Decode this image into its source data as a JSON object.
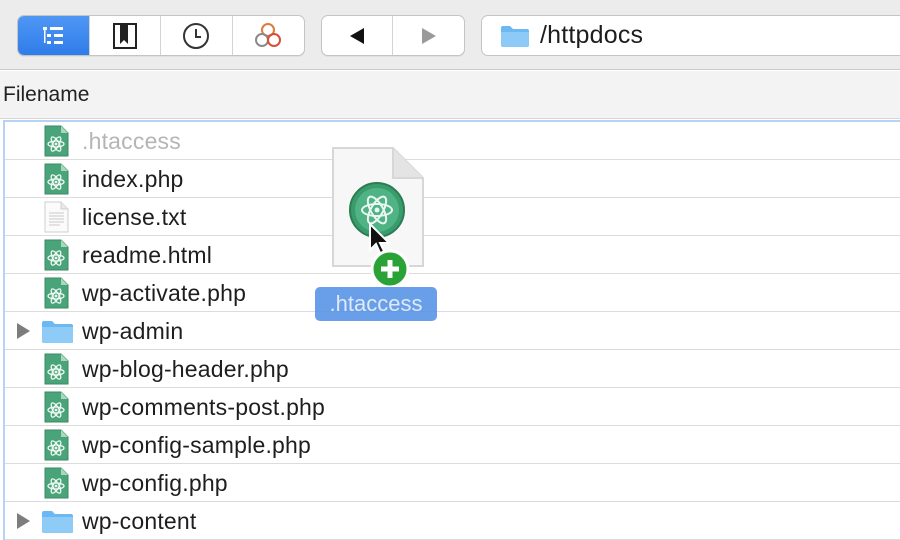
{
  "toolbar": {
    "view_buttons": [
      {
        "icon": "outline-view-icon",
        "active": true
      },
      {
        "icon": "bookmark-icon",
        "active": false
      },
      {
        "icon": "clock-icon",
        "active": false
      },
      {
        "icon": "bonjour-icon",
        "active": false
      }
    ],
    "nav_buttons": [
      {
        "icon": "back-arrow-icon"
      },
      {
        "icon": "forward-arrow-icon"
      }
    ],
    "path": "/httpdocs"
  },
  "column_header": {
    "filename": "Filename"
  },
  "files": [
    {
      "name": ".htaccess",
      "type": "atom-file",
      "dimmed": true
    },
    {
      "name": "index.php",
      "type": "atom-file"
    },
    {
      "name": "license.txt",
      "type": "text-file"
    },
    {
      "name": "readme.html",
      "type": "atom-file"
    },
    {
      "name": "wp-activate.php",
      "type": "atom-file"
    },
    {
      "name": "wp-admin",
      "type": "folder"
    },
    {
      "name": "wp-blog-header.php",
      "type": "atom-file"
    },
    {
      "name": "wp-comments-post.php",
      "type": "atom-file"
    },
    {
      "name": "wp-config-sample.php",
      "type": "atom-file"
    },
    {
      "name": "wp-config.php",
      "type": "atom-file"
    },
    {
      "name": "wp-content",
      "type": "folder"
    }
  ],
  "drag": {
    "label": ".htaccess"
  },
  "colors": {
    "accent": "#2f7de9",
    "folder": "#6cb8f2",
    "atom_green": "#3a9b6b",
    "selection_border": "#b7d2f5",
    "drag_label_bg": "#5492e6",
    "plus_green": "#2aa236"
  }
}
